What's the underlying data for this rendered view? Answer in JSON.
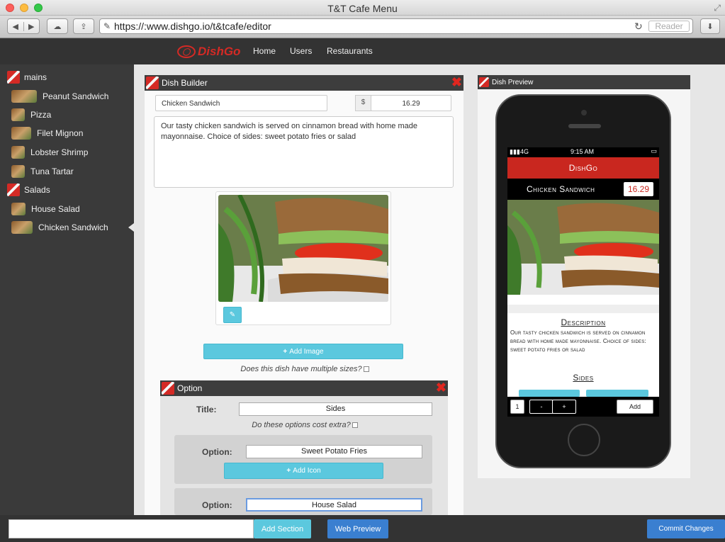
{
  "window": {
    "title": "T&T Cafe Menu"
  },
  "browser": {
    "url": "https://:www.dishgo.io/t&tcafe/editor",
    "reader_label": "Reader"
  },
  "app": {
    "logo": "DishGo",
    "nav": [
      "Home",
      "Users",
      "Restaurants"
    ]
  },
  "sidebar": {
    "sections": [
      {
        "label": "mains",
        "items": [
          "Peanut Sandwich",
          "Pizza",
          "Filet Mignon",
          "Lobster Shrimp",
          "Tuna Tartar"
        ]
      },
      {
        "label": "Salads",
        "items": [
          "House Salad",
          "Chicken Sandwich"
        ]
      }
    ],
    "selected": "Chicken Sandwich"
  },
  "builder": {
    "title": "Dish Builder",
    "dish_name": "Chicken Sandwich",
    "currency_symbol": "$",
    "price": "16.29",
    "description": "Our tasty chicken sandwich is served on cinnamon bread with home made mayonnaise. Choice of sides: sweet potato fries or salad",
    "add_image_label": "Add Image",
    "multiple_sizes_question": "Does this dish have multiple sizes?"
  },
  "option": {
    "title": "Option",
    "title_label": "Title:",
    "title_value": "Sides",
    "cost_question": "Do these options cost extra?",
    "option_label": "Option:",
    "options": [
      "Sweet Potato Fries",
      "House Salad"
    ],
    "add_icon_label": "Add Icon"
  },
  "preview": {
    "title": "Dish Preview",
    "status_carrier": "4G",
    "status_time": "9:15 AM",
    "app_title": "DishGo",
    "dish_name": "Chicken Sandwich",
    "price": "16.29",
    "description_heading": "Description",
    "description": "Our tasty chicken sandwich is served on cinnamon bread with home made mayonnaise. Choice of sides: sweet potato fries or salad",
    "sides_heading": "Sides",
    "quantity": "1",
    "minus": "-",
    "plus": "+",
    "add_label": "Add"
  },
  "bottom": {
    "add_section_label": "Add Section",
    "web_preview_label": "Web Preview",
    "commit_label": "Commit Changes"
  }
}
